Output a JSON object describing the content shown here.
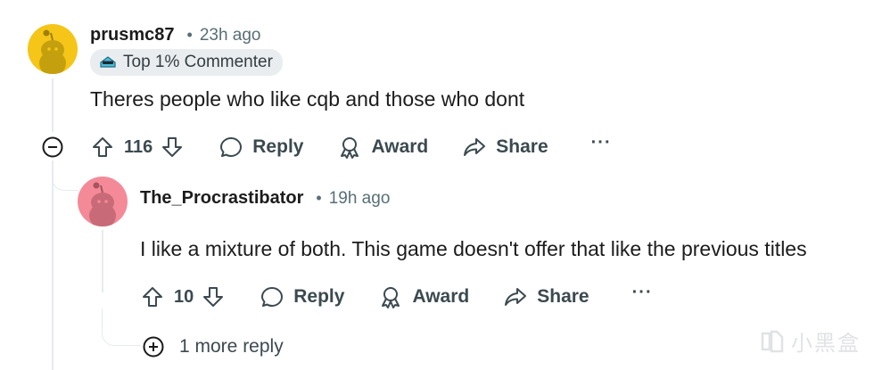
{
  "comments": [
    {
      "username": "prusmc87",
      "time": "23h ago",
      "badge": "Top 1% Commenter",
      "text": "Theres people who like cqb and those who dont",
      "score": "116",
      "avatar_color": "#f5c518",
      "avatar_icon": "snoo-avatar-icon"
    },
    {
      "username": "The_Procrastibator",
      "time": "19h ago",
      "text": "I like a mixture of both. This game doesn't offer that like the previous titles",
      "score": "10",
      "avatar_color": "#f48a98",
      "avatar_icon": "snoo-avatar-icon"
    }
  ],
  "actions": {
    "reply": "Reply",
    "award": "Award",
    "share": "Share",
    "more": "···"
  },
  "more_replies": "1 more reply",
  "watermark": "小黑盒",
  "colors": {
    "meta": "#576f76",
    "action": "#3b4a50",
    "thread_line": "#e5ebee",
    "badge_bg": "#eaedef"
  }
}
